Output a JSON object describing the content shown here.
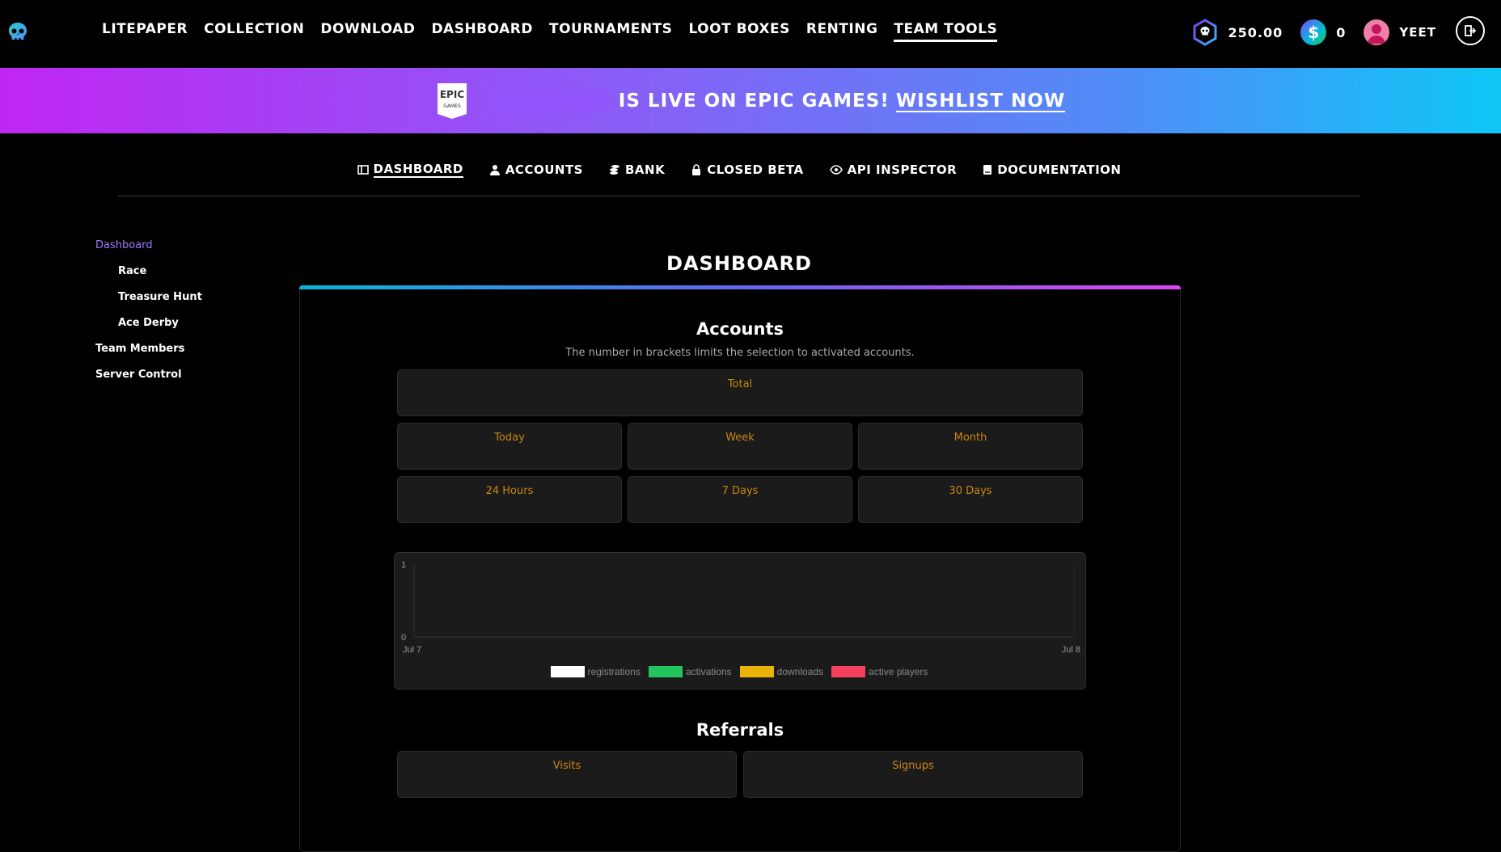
{
  "topnav": {
    "items": [
      "LITEPAPER",
      "COLLECTION",
      "DOWNLOAD",
      "DASHBOARD",
      "TOURNAMENTS",
      "LOOT BOXES",
      "RENTING",
      "TEAM TOOLS"
    ],
    "active": "TEAM TOOLS"
  },
  "wallet": {
    "tokens": "250.00",
    "dollars": "0",
    "username": "YEET"
  },
  "banner": {
    "epic_logo_text": "EPIC",
    "epic_logo_sub": "GAMES",
    "text": "IS LIVE ON EPIC GAMES!",
    "link": "WISHLIST NOW"
  },
  "subnav": {
    "items": [
      "DASHBOARD",
      "ACCOUNTS",
      "BANK",
      "CLOSED BETA",
      "API INSPECTOR",
      "DOCUMENTATION"
    ],
    "active": "DASHBOARD"
  },
  "sidebar": {
    "dashboard": "Dashboard",
    "race": "Race",
    "treasure_hunt": "Treasure Hunt",
    "ace_derby": "Ace Derby",
    "team_members": "Team Members",
    "server_control": "Server Control"
  },
  "page_title": "DASHBOARD",
  "accounts": {
    "title": "Accounts",
    "subtitle": "The number in brackets limits the selection to activated accounts.",
    "total": "Total",
    "today": "Today",
    "week": "Week",
    "month": "Month",
    "h24": "24 Hours",
    "d7": "7 Days",
    "d30": "30 Days"
  },
  "chart_data": {
    "type": "line",
    "x": [
      "Jul 7",
      "Jul 8"
    ],
    "ylim": [
      0,
      1
    ],
    "yticks": [
      "1",
      "0"
    ],
    "xticks": [
      "Jul 7",
      "Jul 8"
    ],
    "series": [
      {
        "name": "registrations",
        "color": "#ffffff",
        "values": []
      },
      {
        "name": "activations",
        "color": "#22c55e",
        "values": []
      },
      {
        "name": "downloads",
        "color": "#eab308",
        "values": []
      },
      {
        "name": "active players",
        "color": "#f43f5e",
        "values": []
      }
    ],
    "legend": "bottom"
  },
  "referrals": {
    "title": "Referrals",
    "visits": "Visits",
    "signups": "Signups"
  }
}
